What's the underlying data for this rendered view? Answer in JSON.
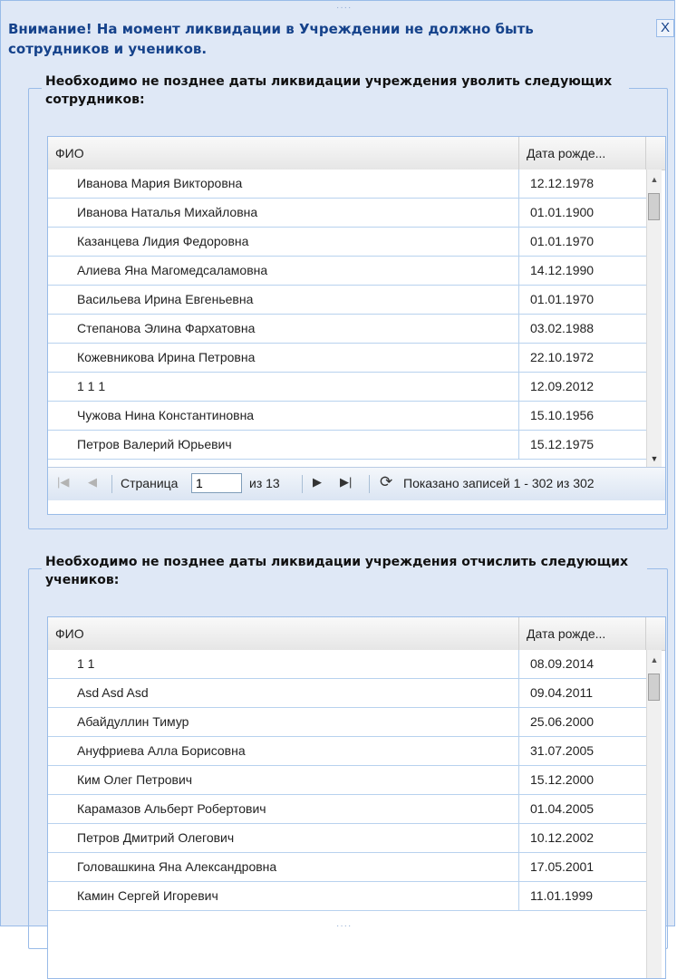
{
  "dialog": {
    "title": "Внимание! На момент ликвидации в Учреждении не должно быть сотрудников и учеников.",
    "close_label": "X"
  },
  "employees": {
    "legend": "Необходимо не позднее даты ликвидации учреждения уволить следующих сотрудников:",
    "columns": [
      "ФИО",
      "Дата рожде..."
    ],
    "rows": [
      {
        "name": "Иванова Мария Викторовна",
        "date": "12.12.1978"
      },
      {
        "name": "Иванова Наталья Михайловна",
        "date": "01.01.1900"
      },
      {
        "name": "Казанцева Лидия Федоровна",
        "date": "01.01.1970"
      },
      {
        "name": "Алиева Яна Магомедсаламовна",
        "date": "14.12.1990"
      },
      {
        "name": "Васильева Ирина Евгеньевна",
        "date": "01.01.1970"
      },
      {
        "name": "Степанова Элина Фархатовна",
        "date": "03.02.1988"
      },
      {
        "name": "Кожевникова Ирина Петровна",
        "date": "22.10.1972"
      },
      {
        "name": "1 1 1",
        "date": "12.09.2012"
      },
      {
        "name": "Чужова Нина Константиновна",
        "date": "15.10.1956"
      },
      {
        "name": "Петров Валерий Юрьевич",
        "date": "15.12.1975"
      }
    ],
    "pager": {
      "page_label": "Страница",
      "page_value": "1",
      "of_label": "из 13",
      "summary": "Показано записей 1 - 302 из 302"
    }
  },
  "students": {
    "legend": "Необходимо не позднее даты ликвидации учреждения отчислить следующих учеников:",
    "columns": [
      "ФИО",
      "Дата рожде..."
    ],
    "rows": [
      {
        "name": "1 1",
        "date": "08.09.2014"
      },
      {
        "name": "Asd Asd Asd",
        "date": "09.04.2011"
      },
      {
        "name": "Абайдуллин Тимур",
        "date": "25.06.2000"
      },
      {
        "name": "Ануфриева Алла Борисовна",
        "date": "31.07.2005"
      },
      {
        "name": "Ким Олег Петрович",
        "date": "15.12.2000"
      },
      {
        "name": "Карамазов Альберт Робертович",
        "date": "01.04.2005"
      },
      {
        "name": "Петров Дмитрий Олегович",
        "date": "10.12.2002"
      },
      {
        "name": "Головашкина Яна Александровна",
        "date": "17.05.2001"
      },
      {
        "name": "Камин Сергей Игоревич",
        "date": "11.01.1999"
      }
    ]
  }
}
